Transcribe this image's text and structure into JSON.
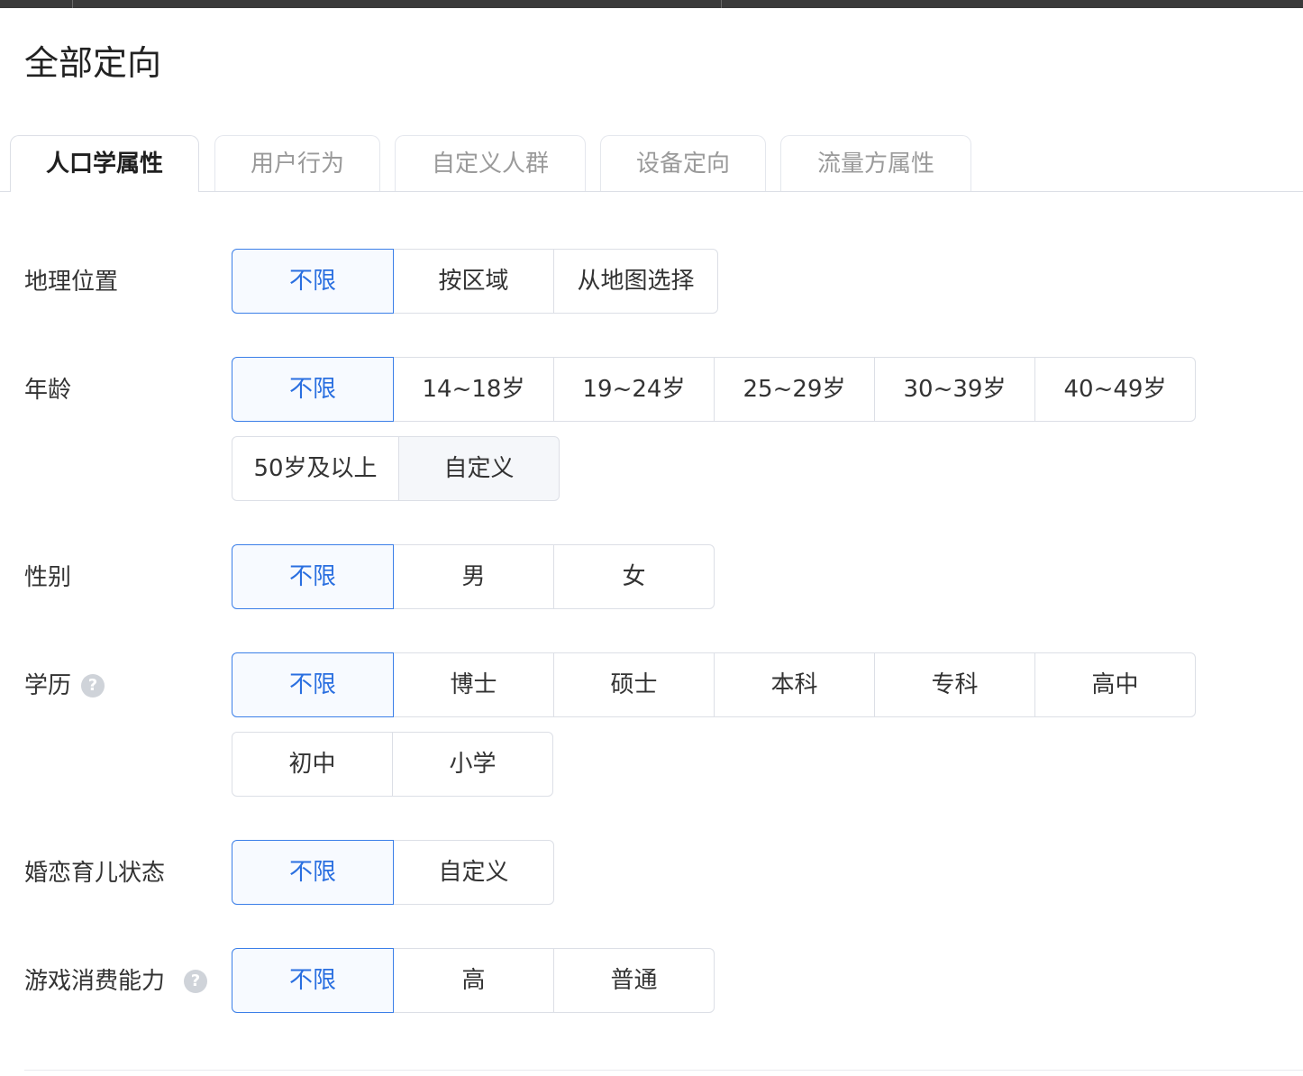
{
  "page": {
    "title": "全部定向"
  },
  "tabs": [
    "人口学属性",
    "用户行为",
    "自定义人群",
    "设备定向",
    "流量方属性"
  ],
  "active_tab": 0,
  "rows": {
    "location": {
      "label": "地理位置",
      "options": [
        "不限",
        "按区域",
        "从地图选择"
      ],
      "selected": "不限"
    },
    "age": {
      "label": "年龄",
      "options": [
        "不限",
        "14~18岁",
        "19~24岁",
        "25~29岁",
        "30~39岁",
        "40~49岁",
        "50岁及以上",
        "自定义"
      ],
      "selected": "不限"
    },
    "gender": {
      "label": "性别",
      "options": [
        "不限",
        "男",
        "女"
      ],
      "selected": "不限"
    },
    "education": {
      "label": "学历",
      "help": "?",
      "options": [
        "不限",
        "博士",
        "硕士",
        "本科",
        "专科",
        "高中",
        "初中",
        "小学"
      ],
      "selected": "不限"
    },
    "marital": {
      "label": "婚恋育儿状态",
      "options": [
        "不限",
        "自定义"
      ],
      "selected": "不限"
    },
    "game_spending": {
      "label": "游戏消费能力",
      "help": "?",
      "options": [
        "不限",
        "高",
        "普通"
      ],
      "selected": "不限"
    }
  },
  "colors": {
    "accent": "#3b7fe8",
    "selected_text": "#2a6fe0",
    "border": "#dcdfe6"
  }
}
